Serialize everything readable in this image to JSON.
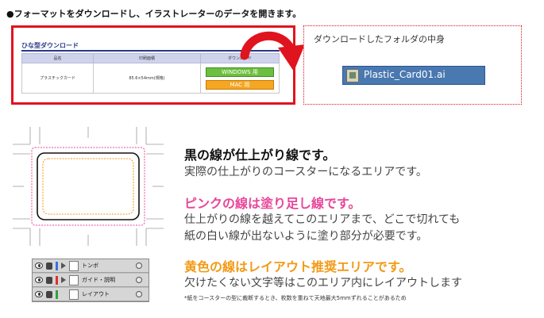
{
  "heading": "●フォーマットをダウンロードし、イラストレーターのデータを開きます。",
  "download_panel": {
    "title": "ひな型ダウンロード",
    "columns": [
      "品名",
      "印刷面積",
      "ダウンロード"
    ],
    "row": {
      "product": "プラスチックカード",
      "size": "85.6×54mm(規格)",
      "windows_button": "WINDOWS 用",
      "mac_button": "MAC 用"
    }
  },
  "folder_panel": {
    "label": "ダウンロードしたフォルダの中身",
    "file_name": "Plastic_Card01.ai"
  },
  "explanation": {
    "black_heading": "黒の線が仕上がり線です。",
    "black_body": "実際の仕上がりのコースターになるエリアです。",
    "pink_heading": "ピンクの線は塗り足し線です。",
    "pink_body_1": "仕上がりの線を越えてこのエリアまで、どこで切れても",
    "pink_body_2": "紙の白い線が出ないように塗り部分が必要です。",
    "yellow_heading": "黄色の線はレイアウト推奨エリアです。",
    "yellow_body": "欠けたくない文字等はこのエリア内にレイアウトします",
    "note": "*紙をコースターの型に裁断するとき、枚数を重ねて天地最大5mmずれることがあるため"
  },
  "layers": [
    {
      "name": "トンボ",
      "swatch": "#3a6fd8"
    },
    {
      "name": "ガイド・説明",
      "swatch": "#e03030"
    },
    {
      "name": "レイアウト",
      "swatch": "#30a040"
    }
  ],
  "colors": {
    "red_frame": "#e0141e",
    "pink_line": "#e8479a",
    "yellow_line": "#f29a16",
    "win_green": "#6cbf3f",
    "mac_orange": "#f5a623",
    "file_highlight": "#4a78b0"
  }
}
